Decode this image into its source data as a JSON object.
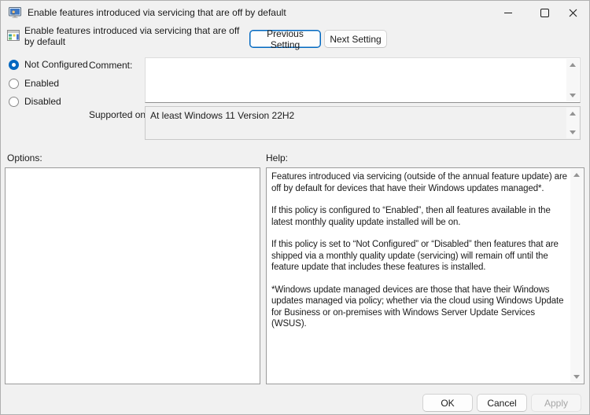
{
  "window": {
    "title": "Enable features introduced via servicing that are off by default"
  },
  "header": {
    "policy_title": "Enable features introduced via servicing that are off by default",
    "previous_button": "Previous Setting",
    "next_button": "Next Setting"
  },
  "state": {
    "options": [
      {
        "label": "Not Configured",
        "selected": true
      },
      {
        "label": "Enabled",
        "selected": false
      },
      {
        "label": "Disabled",
        "selected": false
      }
    ]
  },
  "comment": {
    "label": "Comment:",
    "value": ""
  },
  "supported": {
    "label": "Supported on:",
    "value": "At least Windows 11 Version 22H2"
  },
  "options_panel": {
    "label": "Options:"
  },
  "help_panel": {
    "label": "Help:",
    "paragraphs": [
      "Features introduced via servicing (outside of the annual feature update) are off by default for devices that have their Windows updates managed*.",
      "If this policy is configured to “Enabled”, then all features available in the latest monthly quality update installed will be on.",
      "If this policy is set to “Not Configured” or “Disabled” then features that are shipped via a monthly quality update (servicing) will remain off until the feature update that includes these features is installed.",
      "*Windows update managed devices are those that have their Windows updates managed via policy; whether via the cloud using Windows Update for Business or on-premises with Windows Server Update Services (WSUS)."
    ]
  },
  "footer": {
    "ok": "OK",
    "cancel": "Cancel",
    "apply": "Apply"
  },
  "colors": {
    "accent": "#0067c0",
    "dialog_bg": "#f1f1f1",
    "panel_border": "#9b9b9b"
  }
}
